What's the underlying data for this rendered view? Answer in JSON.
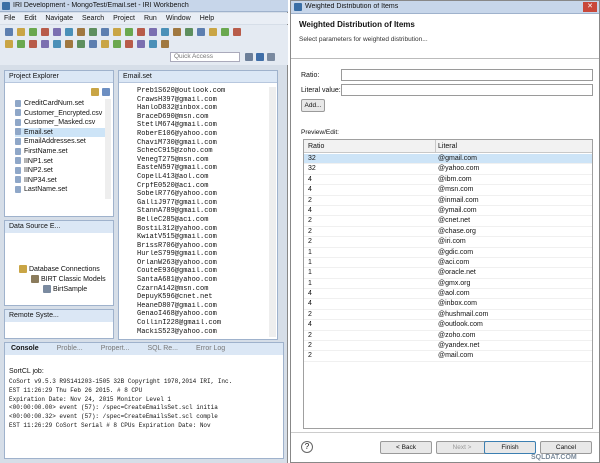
{
  "workbench": {
    "title": "IRI Development - MongoTest/Email.set - IRI Workbench",
    "menu": [
      "File",
      "Edit",
      "Navigate",
      "Search",
      "Project",
      "Run",
      "Window",
      "Help"
    ],
    "quick_access": "Quick Access",
    "project_explorer": {
      "title": "Project Explorer",
      "items": [
        "CreditCardNum.set",
        "Customer_Encrypted.csv",
        "Customer_Masked.csv",
        "Email.set",
        "EmailAddresses.set",
        "FirstName.set",
        "IINP1.set",
        "IINP2.set",
        "IINP34.set",
        "LastName.set"
      ]
    },
    "data_source": {
      "title": "Data Source E...",
      "items": [
        "Database Connections",
        "BIRT Classic Models",
        "BirtSample"
      ]
    },
    "remote_systems": {
      "title": "Remote Syste..."
    },
    "editor": {
      "tab": "Email.set",
      "lines": [
        "Preb1S620@outlook.com",
        "CrawsH397@gmail.com",
        "HanloD832@inbox.com",
        "BraceD690@msn.com",
        "StetlM674@gmail.com",
        "RoberE106@yahoo.com",
        "ChaviM730@gmail.com",
        "SchecC915@zoho.com",
        "VenegT275@msn.com",
        "EasteN597@gmail.com",
        "CopelL413@aol.com",
        "CrpfE0520@aci.com",
        "SobelR776@yahoo.com",
        "GalliJ977@gmail.com",
        "StannA789@gmail.com",
        "BelleC285@aci.com",
        "BostiL312@yahoo.com",
        "KwiatV515@gmail.com",
        "BrissR706@yahoo.com",
        "HurleS799@gmail.com",
        "OrlanW263@yahoo.com",
        "CouteE936@gmail.com",
        "SantaA681@yahoo.com",
        "CzarnA142@msn.com",
        "DepuyK596@cnet.net",
        "HeaneD807@gmail.com",
        "GenaoI468@yahoo.com",
        "CollinI228@gmail.com",
        "MackiS523@yahoo.com"
      ]
    },
    "console": {
      "tabs": [
        "Console",
        "Proble...",
        "Propert...",
        "SQL Re...",
        "Error Log"
      ],
      "job": "SortCL job:",
      "lines": [
        "CoSort v9.5.3 R9S141203-1505 32B Copyright 1978,2014 IRI, Inc.",
        "EST 11:26:29  Thu Feb 26 2015.  # 8 CPU",
        "Expiration Date: Nov 24, 2015 Monitor Level 1",
        "   <00:00:00.00> event (57): /spec=CreateEmailsSet.scl  initia",
        "   <00:00:00.32> event (57): /spec=CreateEmailsSet.scl  comple",
        "EST 11:26:29     CoSort Serial #   8 CPUs  Expiration Date: Nov"
      ]
    }
  },
  "dialog": {
    "title": "Weighted Distribution of Items",
    "heading": "Weighted Distribution of Items",
    "subtitle": "Select parameters for weighted distribution...",
    "ratio_label": "Ratio:",
    "literal_label": "Literal value:",
    "add_button": "Add...",
    "preview_label": "Preview/Edit:",
    "columns": [
      "Ratio",
      "Literal"
    ],
    "rows": [
      [
        "32",
        "@gmail.com"
      ],
      [
        "32",
        "@yahoo.com"
      ],
      [
        "4",
        "@ibm.com"
      ],
      [
        "4",
        "@msn.com"
      ],
      [
        "2",
        "@inmail.com"
      ],
      [
        "4",
        "@ymail.com"
      ],
      [
        "2",
        "@cnet.net"
      ],
      [
        "2",
        "@chase.org"
      ],
      [
        "2",
        "@iri.com"
      ],
      [
        "1",
        "@gdic.com"
      ],
      [
        "1",
        "@aci.com"
      ],
      [
        "1",
        "@oracle.net"
      ],
      [
        "1",
        "@gmx.org"
      ],
      [
        "4",
        "@aol.com"
      ],
      [
        "4",
        "@inbox.com"
      ],
      [
        "2",
        "@hushmail.com"
      ],
      [
        "4",
        "@outlook.com"
      ],
      [
        "2",
        "@zoho.com"
      ],
      [
        "2",
        "@yandex.net"
      ],
      [
        "2",
        "@mail.com"
      ]
    ],
    "buttons": {
      "help": "?",
      "back": "< Back",
      "next": "Next >",
      "finish": "Finish",
      "cancel": "Cancel"
    }
  },
  "watermark": "SQLDAT.COM",
  "colors": {
    "accent": "#2b5797",
    "selection": "#cde4f7",
    "view_tab": "#dbe7f5"
  }
}
